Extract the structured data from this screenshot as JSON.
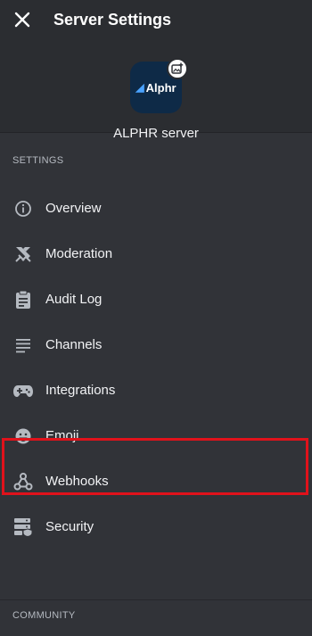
{
  "header": {
    "title": "Server Settings",
    "close_icon": "close-icon"
  },
  "server": {
    "name": "ALPHR server",
    "logo_text": "Alphr",
    "upload_icon": "image-upload-icon"
  },
  "sections": {
    "settings": "SETTINGS",
    "community": "COMMUNITY"
  },
  "menu": [
    {
      "label": "Overview",
      "icon": "info-icon"
    },
    {
      "label": "Moderation",
      "icon": "swords-icon"
    },
    {
      "label": "Audit Log",
      "icon": "clipboard-icon"
    },
    {
      "label": "Channels",
      "icon": "list-icon"
    },
    {
      "label": "Integrations",
      "icon": "gamepad-icon"
    },
    {
      "label": "Emoji",
      "icon": "emoji-icon",
      "highlighted": true
    },
    {
      "label": "Webhooks",
      "icon": "webhook-icon"
    },
    {
      "label": "Security",
      "icon": "server-security-icon"
    }
  ],
  "colors": {
    "highlight": "#e0121b",
    "background": "#313338",
    "header_bg": "#2b2d31"
  }
}
